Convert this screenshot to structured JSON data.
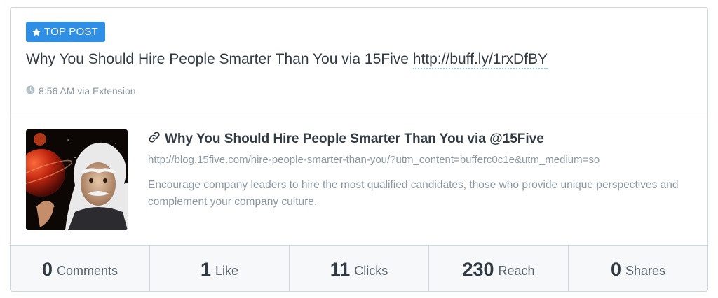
{
  "badge": {
    "icon": "star-icon",
    "label": "TOP POST",
    "color": "#2f8fe5"
  },
  "post": {
    "text": "Why You Should Hire People Smarter Than You via 15Five ",
    "link": "http://buff.ly/1rxDfBY",
    "meta_icon": "clock-icon",
    "meta": "8:56 AM via Extension"
  },
  "attachment": {
    "thumbnail_icon": "einstein-thumbnail",
    "title_icon": "link-icon",
    "title": "Why You Should Hire People Smarter Than You via @15Five",
    "url": "http://blog.15five.com/hire-people-smarter-than-you/?utm_content=bufferc0c1e&utm_medium=so",
    "description": "Encourage company leaders to hire the most qualified candidates, those who provide unique perspectives and complement your company culture."
  },
  "stats": [
    {
      "value": "0",
      "label": "Comments"
    },
    {
      "value": "1",
      "label": "Like"
    },
    {
      "value": "11",
      "label": "Clicks"
    },
    {
      "value": "230",
      "label": "Reach"
    },
    {
      "value": "0",
      "label": "Shares"
    }
  ]
}
